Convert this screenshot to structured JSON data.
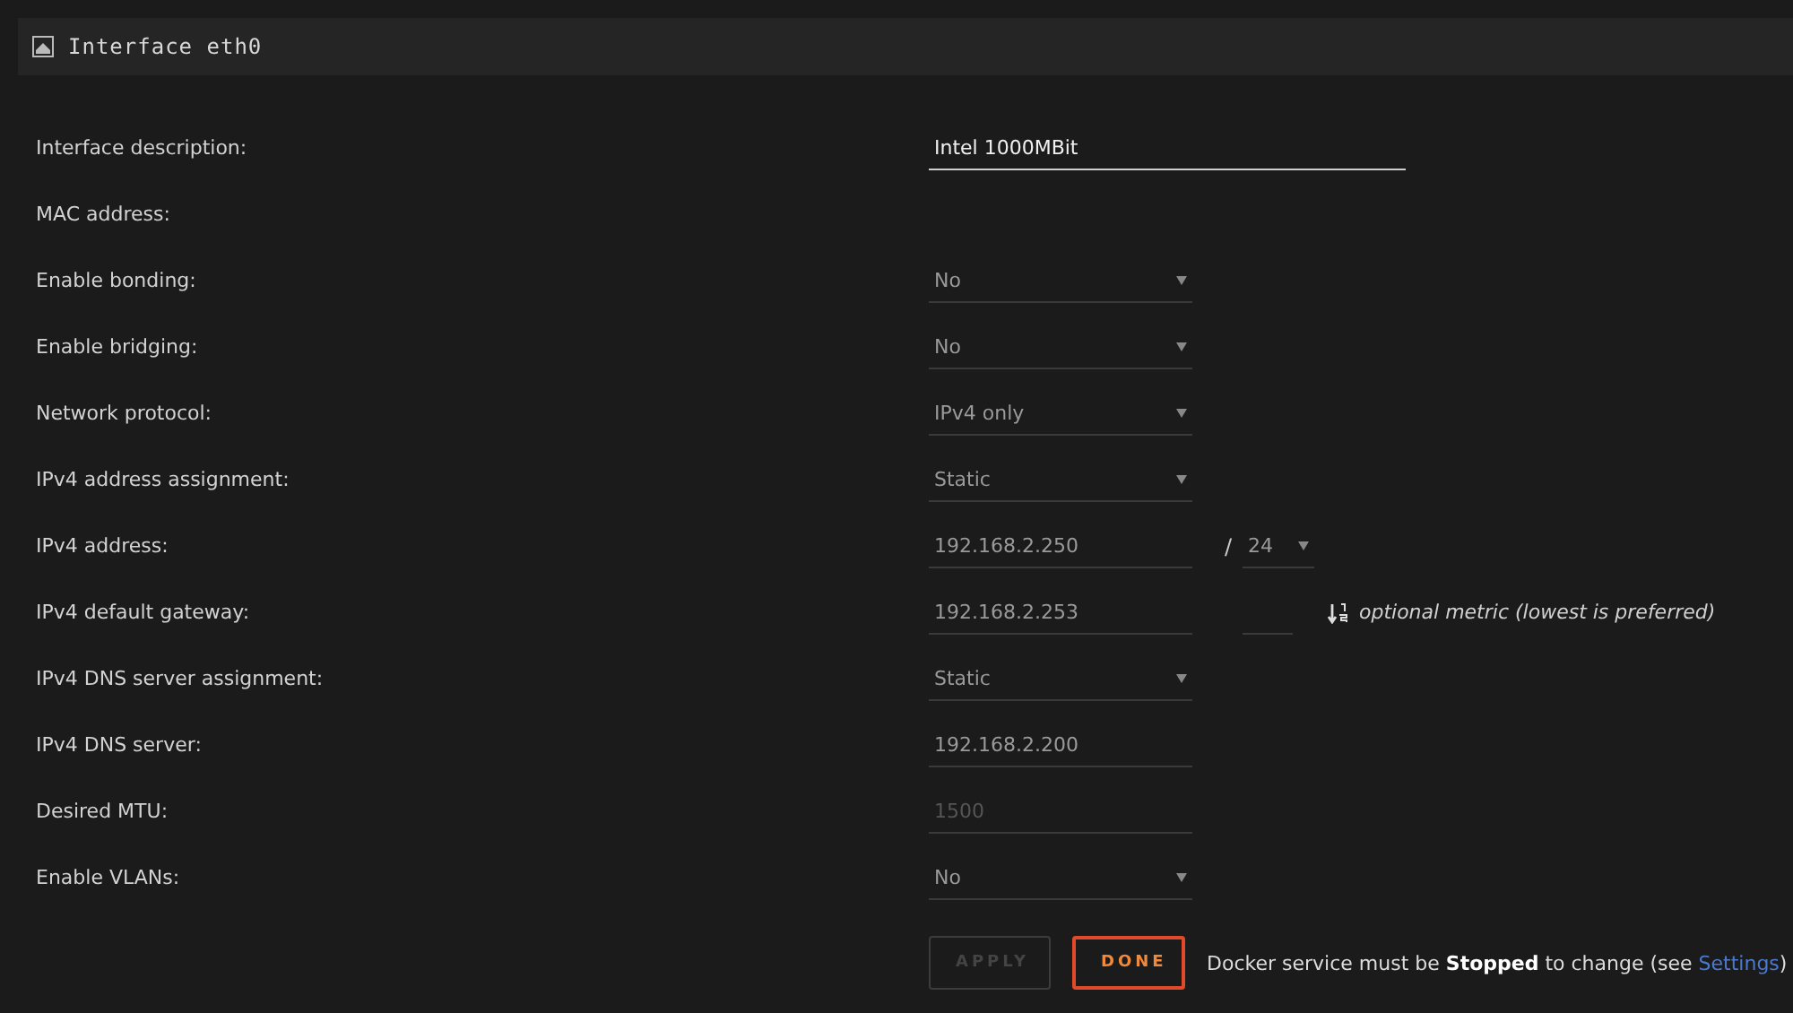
{
  "header": {
    "title": "Interface eth0"
  },
  "rows": [
    {
      "label": "Interface description:",
      "kind": "active-input",
      "value": "Intel 1000MBit"
    },
    {
      "label": "MAC address:",
      "kind": "blank"
    },
    {
      "label": "Enable bonding:",
      "kind": "select",
      "value": "No"
    },
    {
      "label": "Enable bridging:",
      "kind": "select",
      "value": "No"
    },
    {
      "label": "Network protocol:",
      "kind": "select",
      "value": "IPv4 only"
    },
    {
      "label": "IPv4 address assignment:",
      "kind": "select",
      "value": "Static"
    },
    {
      "label": "IPv4 address:",
      "kind": "ip-prefix",
      "value": "192.168.2.250",
      "separator": "/",
      "prefix": "24"
    },
    {
      "label": "IPv4 default gateway:",
      "kind": "ip-metric",
      "value": "192.168.2.253",
      "hint": "optional metric (lowest is preferred)"
    },
    {
      "label": "IPv4 DNS server assignment:",
      "kind": "select",
      "value": "Static"
    },
    {
      "label": "IPv4 DNS server:",
      "kind": "input",
      "value": "192.168.2.200"
    },
    {
      "label": "Desired MTU:",
      "kind": "placeholder-input",
      "placeholder": "1500"
    },
    {
      "label": "Enable VLANs:",
      "kind": "select",
      "value": "No"
    }
  ],
  "buttons": [
    {
      "label": "APPLY",
      "disabled": true
    },
    {
      "label": "DONE",
      "disabled": false
    }
  ],
  "message": {
    "before": "Docker service must be **Stopped** to change (see ",
    "link": "Settings",
    "after": ")"
  }
}
